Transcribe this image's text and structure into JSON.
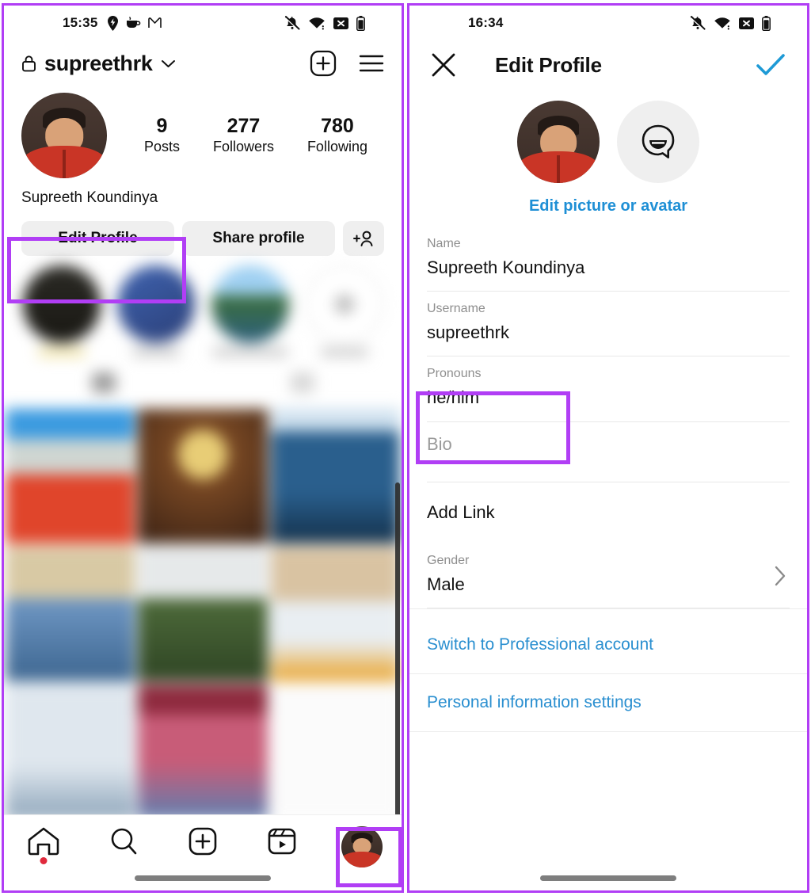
{
  "theme": {
    "highlight": "#b13ef5",
    "link_blue": "#2a8fd0",
    "avatar_link_blue": "#1e8fd5",
    "pill_bg": "#efefef",
    "badge_red": "#e0293c"
  },
  "left_phone": {
    "status_bar": {
      "time": "15:35",
      "left_icons": [
        "location-pin-icon",
        "coffee-cup-icon",
        "gmail-icon"
      ],
      "right_icons": [
        "notifications-off-icon",
        "wifi-icon",
        "no-sim-icon",
        "battery-icon"
      ]
    },
    "header": {
      "lock_icon": "lock-icon",
      "username": "supreethrk",
      "chevron_icon": "chevron-down-icon",
      "create_icon": "plus-square-icon",
      "menu_icon": "hamburger-menu-icon"
    },
    "profile": {
      "avatar": "profile-avatar",
      "full_name": "Supreeth Koundinya",
      "stats": [
        {
          "number": "9",
          "label": "Posts"
        },
        {
          "number": "277",
          "label": "Followers"
        },
        {
          "number": "780",
          "label": "Following"
        }
      ]
    },
    "actions": {
      "edit_profile": "Edit Profile",
      "share_profile": "Share profile",
      "add_people_icon": "add-person-icon"
    },
    "bottom_nav": [
      {
        "name": "home",
        "icon": "home-icon",
        "badge": true
      },
      {
        "name": "search",
        "icon": "search-icon",
        "badge": false
      },
      {
        "name": "create",
        "icon": "plus-square-icon",
        "badge": false
      },
      {
        "name": "reels",
        "icon": "reels-icon",
        "badge": false
      },
      {
        "name": "profile",
        "icon": "profile-avatar-icon",
        "badge": false
      }
    ]
  },
  "right_phone": {
    "status_bar": {
      "time": "16:34",
      "right_icons": [
        "notifications-off-icon",
        "wifi-icon",
        "no-sim-icon",
        "battery-icon"
      ]
    },
    "header": {
      "close_icon": "close-x-icon",
      "title": "Edit Profile",
      "confirm_icon": "checkmark-icon"
    },
    "avatar_section": {
      "profile_picture": "profile-avatar",
      "avatar_option_icon": "avatar-face-icon",
      "edit_link": "Edit picture or avatar"
    },
    "fields": [
      {
        "label": "Name",
        "value": "Supreeth Koundinya",
        "placeholder": false,
        "chevron": false
      },
      {
        "label": "Username",
        "value": "supreethrk",
        "placeholder": false,
        "chevron": false
      },
      {
        "label": "Pronouns",
        "value": "he/him",
        "placeholder": false,
        "chevron": false
      },
      {
        "label": "Bio",
        "value": "",
        "placeholder": true,
        "chevron": false
      }
    ],
    "add_link": "Add Link",
    "gender_field": {
      "label": "Gender",
      "value": "Male",
      "chevron_icon": "chevron-right-icon"
    },
    "links": [
      "Switch to Professional account",
      "Personal information settings"
    ]
  },
  "annotations": [
    {
      "name": "edit-profile-highlight",
      "target": "Edit Profile button"
    },
    {
      "name": "pronouns-field-highlight",
      "target": "Pronouns field"
    },
    {
      "name": "profile-tab-highlight",
      "target": "Profile tab in bottom nav"
    }
  ]
}
